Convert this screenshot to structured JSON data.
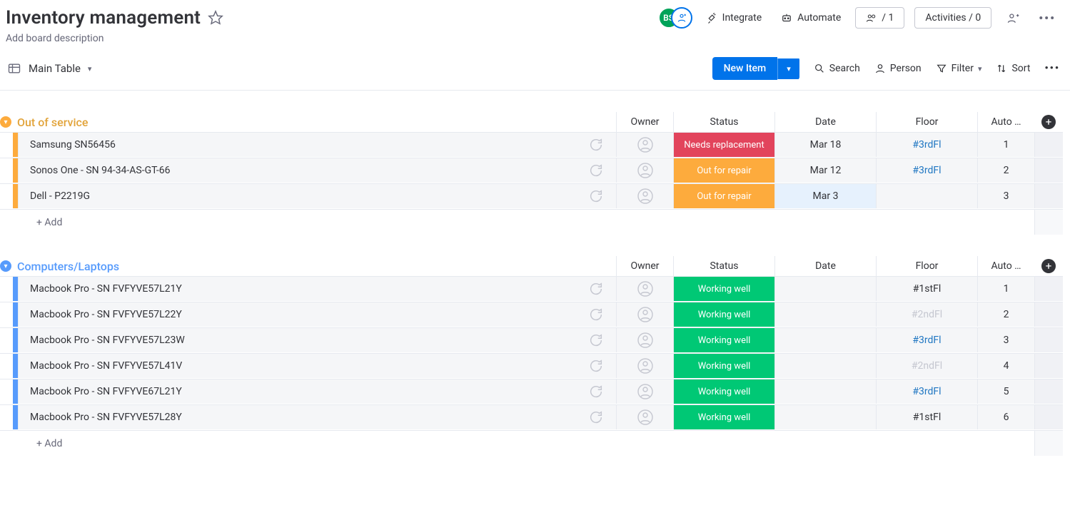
{
  "header": {
    "title": "Inventory management",
    "description": "Add board description",
    "avatar_initials": "BS",
    "integrate_label": "Integrate",
    "automate_label": "Automate",
    "invite_label": "/ 1",
    "activities_label": "Activities / 0"
  },
  "view": {
    "name": "Main Table",
    "new_item_label": "New Item",
    "search_label": "Search",
    "person_label": "Person",
    "filter_label": "Filter",
    "sort_label": "Sort"
  },
  "columns": {
    "owner": "Owner",
    "status": "Status",
    "date": "Date",
    "floor": "Floor",
    "auto": "Auto …"
  },
  "add_row_label": "+ Add",
  "status_colors": {
    "Needs replacement": "#e2445c",
    "Out for repair": "#fdab3d",
    "Working well": "#00c875"
  },
  "groups": [
    {
      "id": "out-of-service",
      "title": "Out of service",
      "color": "#fdab3d",
      "title_color": "#e2a43b",
      "rows": [
        {
          "name": "Samsung SN56456",
          "status": "Needs replacement",
          "date": "Mar 18",
          "floor": "#3rdFl",
          "floor_link": true,
          "auto": "1",
          "date_selected": false
        },
        {
          "name": "Sonos One - SN 94-34-AS-GT-66",
          "status": "Out for repair",
          "date": "Mar 12",
          "floor": "#3rdFl",
          "floor_link": true,
          "auto": "2",
          "date_selected": false
        },
        {
          "name": "Dell - P2219G",
          "status": "Out for repair",
          "date": "Mar 3",
          "floor": "",
          "floor_link": false,
          "auto": "3",
          "date_selected": true
        }
      ]
    },
    {
      "id": "computers-laptops",
      "title": "Computers/Laptops",
      "color": "#579bfc",
      "title_color": "#579bfc",
      "rows": [
        {
          "name": "Macbook Pro - SN FVFYVE57L21Y",
          "status": "Working well",
          "date": "",
          "floor": "#1stFl",
          "floor_link": false,
          "auto": "1"
        },
        {
          "name": "Macbook Pro - SN FVFYVE57L22Y",
          "status": "Working well",
          "date": "",
          "floor": "#2ndFl",
          "floor_link": false,
          "floor_grey": true,
          "auto": "2"
        },
        {
          "name": "Macbook Pro - SN FVFYVE57L23W",
          "status": "Working well",
          "date": "",
          "floor": "#3rdFl",
          "floor_link": true,
          "auto": "3"
        },
        {
          "name": "Macbook Pro - SN FVFYVE57L41V",
          "status": "Working well",
          "date": "",
          "floor": "#2ndFl",
          "floor_link": false,
          "floor_grey": true,
          "auto": "4"
        },
        {
          "name": "Macbook Pro - SN FVFYVE67L21Y",
          "status": "Working well",
          "date": "",
          "floor": "#3rdFl",
          "floor_link": true,
          "auto": "5"
        },
        {
          "name": "Macbook Pro - SN FVFYVE57L28Y",
          "status": "Working well",
          "date": "",
          "floor": "#1stFl",
          "floor_link": false,
          "auto": "6"
        }
      ]
    }
  ]
}
